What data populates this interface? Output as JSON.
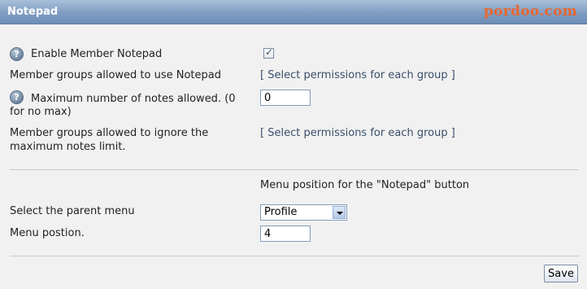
{
  "header": {
    "title": "Notepad",
    "watermark": "pordoo.com"
  },
  "settings": {
    "enable_member_notepad": {
      "label": "Enable Member Notepad",
      "checked": true,
      "help_icon": "question-icon"
    },
    "member_groups_allowed": {
      "label": "Member groups allowed to use Notepad",
      "link": "[ Select permissions for each group ]"
    },
    "max_notes": {
      "label_line1": "Maximum number of notes allowed. (0",
      "label_line2": "for no max)",
      "value": "0",
      "help_icon": "question-icon"
    },
    "member_groups_ignore_limit": {
      "label_line1": "Member groups allowed to ignore the",
      "label_line2": "maximum notes limit.",
      "link": "[ Select permissions for each group ]"
    },
    "menu_section_heading": "Menu position for the \"Notepad\" button",
    "parent_menu": {
      "label": "Select the parent menu",
      "selected": "Profile"
    },
    "menu_position": {
      "label": "Menu postion.",
      "value": "4"
    }
  },
  "actions": {
    "save_label": "Save"
  },
  "colors": {
    "title_bar": "#7f9dc2",
    "panel_background": "#f1f1f1",
    "watermark": "#e8672f",
    "link": "#3a4f6a"
  }
}
